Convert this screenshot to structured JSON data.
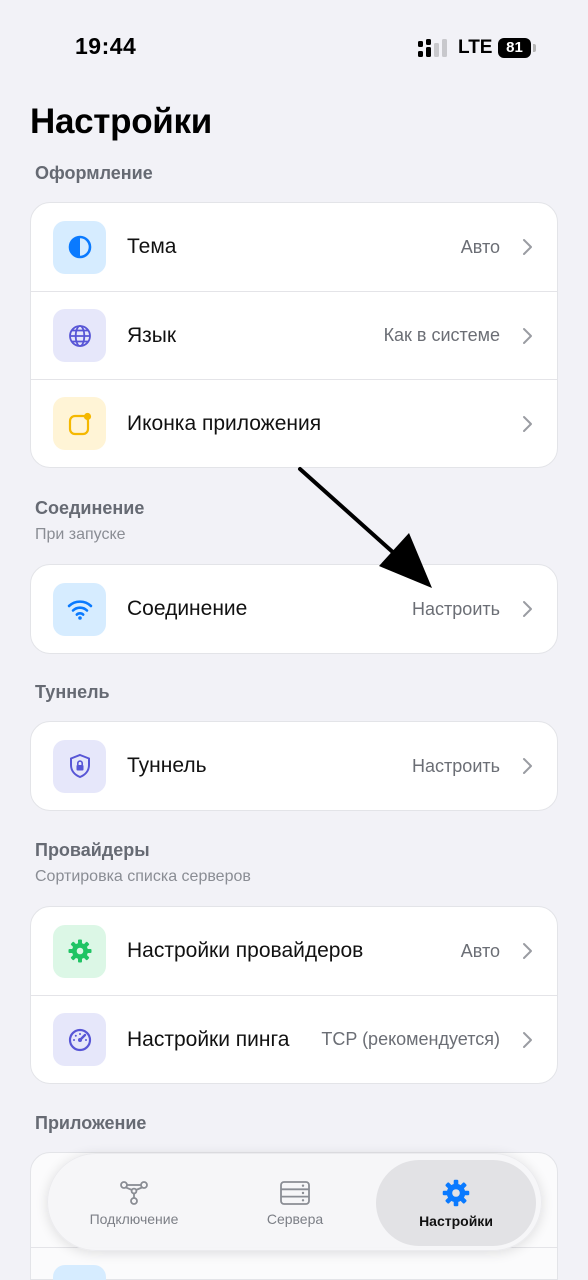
{
  "status_bar": {
    "time": "19:44",
    "network": "LTE",
    "battery": "81"
  },
  "page_title": "Настройки",
  "sections": {
    "appearance": {
      "header": "Оформление",
      "rows": [
        {
          "label": "Тема",
          "value": "Авто",
          "icon": "theme-icon"
        },
        {
          "label": "Язык",
          "value": "Как в системе",
          "icon": "globe-icon"
        },
        {
          "label": "Иконка приложения",
          "value": "",
          "icon": "app-icon-icon"
        }
      ]
    },
    "connection": {
      "header": "Соединение",
      "subtitle": "При запуске",
      "rows": [
        {
          "label": "Соединение",
          "value": "Настроить",
          "icon": "wifi-icon"
        }
      ]
    },
    "tunnel": {
      "header": "Туннель",
      "rows": [
        {
          "label": "Туннель",
          "value": "Настроить",
          "icon": "shield-lock-icon"
        }
      ]
    },
    "providers": {
      "header": "Провайдеры",
      "subtitle": "Сортировка списка серверов",
      "rows": [
        {
          "label": "Настройки провайдеров",
          "value": "Авто",
          "icon": "gear-icon"
        },
        {
          "label": "Настройки пинга",
          "value": "TCP (рекомендуется)",
          "icon": "speedometer-icon"
        }
      ]
    },
    "app": {
      "header": "Приложение"
    }
  },
  "tabbar": {
    "tabs": [
      {
        "label": "Подключение",
        "icon": "connection-nodes-icon",
        "active": false
      },
      {
        "label": "Сервера",
        "icon": "servers-icon",
        "active": false
      },
      {
        "label": "Настройки",
        "icon": "gear-icon",
        "active": true
      }
    ]
  },
  "colors": {
    "accent": "#0a7aff",
    "background": "#f2f2f7",
    "theme_tile": "#d6ecff",
    "language_tile": "#e6e7fa",
    "app_icon_tile": "#fff4d6",
    "wifi_tile": "#d6ecff",
    "tunnel_tile": "#e6e7fa",
    "providers_tile": "#dcf7e6",
    "ping_tile": "#e6e7fa"
  }
}
